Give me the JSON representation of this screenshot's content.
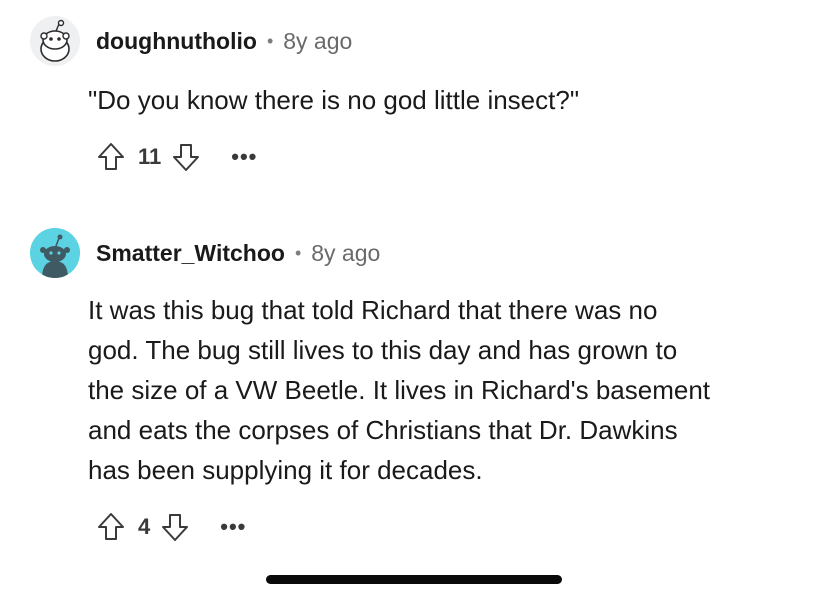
{
  "comments": [
    {
      "username": "doughnutholio",
      "separator": "•",
      "age": "8y ago",
      "text": "\"Do you know there is no god little insect?\"",
      "score": "11",
      "more": "•••",
      "avatar_color": "#eef0f2"
    },
    {
      "username": "Smatter_Witchoo",
      "separator": "•",
      "age": "8y ago",
      "text_lines": [
        "It was this bug that told Richard that there was no",
        "god. The bug still lives to this day and has grown to",
        "the size of a VW Beetle. It lives in Richard's basement",
        "and eats the corpses of Christians that Dr. Dawkins",
        "has been supplying it for decades."
      ],
      "score": "4",
      "more": "•••",
      "avatar_color": "#5bd3e3"
    }
  ]
}
